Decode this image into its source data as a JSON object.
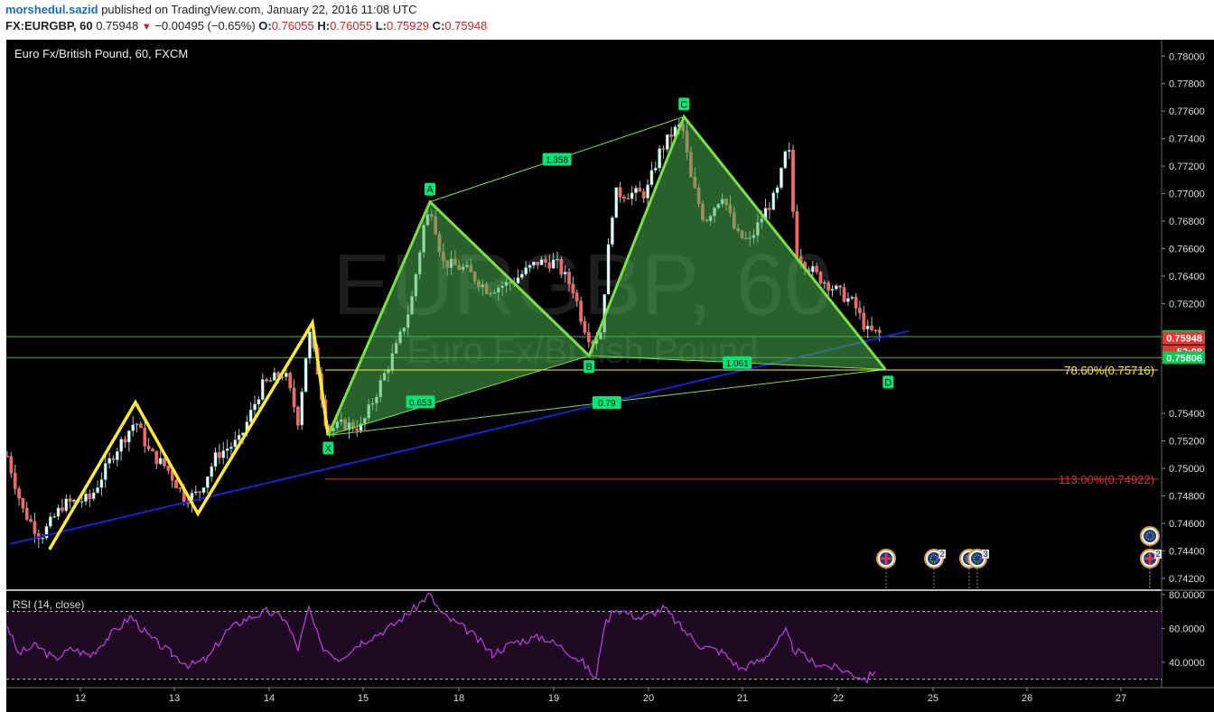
{
  "header": {
    "user": "morshedul.sazid",
    "published_text": "published on TradingView.com, January 22, 2016 11:08 UTC",
    "symbol": "FX:EURGBP, 60",
    "last": "0.75948",
    "change_arrow": "▼",
    "change": "−0.00495 (−0.65%)",
    "o_label": "O:",
    "o_value": "0.76055",
    "h_label": "H:",
    "h_value": "0.76055",
    "l_label": "L:",
    "l_value": "0.75929",
    "c_label": "C:",
    "c_value": "0.75948"
  },
  "chart_data": {
    "type": "candlestick",
    "title": "Euro Fx/British Pound, 60, FXCM",
    "watermark": "EURGBP, 60",
    "watermark_sub": "Euro Fx/British Pound",
    "x_tick_labels": [
      "12",
      "13",
      "14",
      "15",
      "18",
      "19",
      "20",
      "21",
      "22",
      "25",
      "26",
      "27"
    ],
    "y_tick_labels": [
      "0.78000",
      "0.77800",
      "0.77600",
      "0.77400",
      "0.77200",
      "0.77000",
      "0.76800",
      "0.76600",
      "0.76400",
      "0.76200",
      "0.75800",
      "0.75400",
      "0.75200",
      "0.75000",
      "0.74800",
      "0.74600",
      "0.74400",
      "0.74200"
    ],
    "ylim": [
      0.7412,
      0.7812
    ],
    "price_labels": [
      {
        "text": "0.75959",
        "value": 0.75959,
        "color": "#00c853"
      },
      {
        "text": "0.75948",
        "value": 0.75948,
        "color": "#e53935"
      },
      {
        "text": "52:08",
        "value": 0.7583,
        "color": "#e53935"
      },
      {
        "text": "0.75806",
        "value": 0.75806,
        "color": "#00c853"
      }
    ],
    "horizontal_lines": [
      {
        "value": 0.75959,
        "color": "#4caf50"
      },
      {
        "value": 0.75806,
        "color": "#4caf50"
      }
    ],
    "harmonic_pattern": {
      "points": [
        {
          "label": "X",
          "x": "2016-01-14 15:00",
          "y": 0.7524
        },
        {
          "label": "A",
          "x": "2016-01-15 17:00",
          "y": 0.7694
        },
        {
          "label": "B",
          "x": "2016-01-19 09:00",
          "y": 0.7582
        },
        {
          "label": "C",
          "x": "2016-01-20 09:00",
          "y": 0.7756
        },
        {
          "label": "D",
          "x": "2016-01-22 12:00",
          "y": 0.7572
        }
      ],
      "ratios": [
        {
          "text": "0.653",
          "between": "XA-AB"
        },
        {
          "text": "1.358",
          "between": "AB-BC"
        },
        {
          "text": "0.79",
          "between": "XA-AD"
        },
        {
          "text": "1.061",
          "between": "BC-CD"
        }
      ],
      "levels": [
        {
          "text": "78.60%(0.75716)",
          "value": 0.75716,
          "color": "#ffeb3b"
        },
        {
          "text": "113.00%(0.74922)",
          "value": 0.74922,
          "color": "#d32f2f"
        }
      ]
    },
    "zigzag": [
      {
        "x": "2016-01-11 16:00",
        "y": 0.7441
      },
      {
        "x": "2016-01-12 14:00",
        "y": 0.7548
      },
      {
        "x": "2016-01-13 06:00",
        "y": 0.7467
      },
      {
        "x": "2016-01-14 11:00",
        "y": 0.7606
      },
      {
        "x": "2016-01-14 15:00",
        "y": 0.7524
      }
    ],
    "trendline": {
      "from": {
        "x": "2016-01-11 06:00",
        "y": 0.7445
      },
      "to": {
        "x": "2016-01-22 18:00",
        "y": 0.76
      },
      "color": "#1a23c9"
    },
    "events": [
      {
        "flag": "gb",
        "count": ""
      },
      {
        "flag": "eu",
        "count": "2"
      },
      {
        "flag": "eu",
        "count": "3"
      },
      {
        "flag": "eu",
        "count": "3"
      },
      {
        "flag": "eu",
        "count": ""
      },
      {
        "flag": "gb",
        "count": "2"
      }
    ],
    "rsi": {
      "label": "RSI (14, close)",
      "ylim": [
        25,
        82
      ],
      "y_tick_labels": [
        "80.0000",
        "60.0000",
        "40.0000"
      ],
      "bands": [
        70,
        30
      ]
    }
  }
}
